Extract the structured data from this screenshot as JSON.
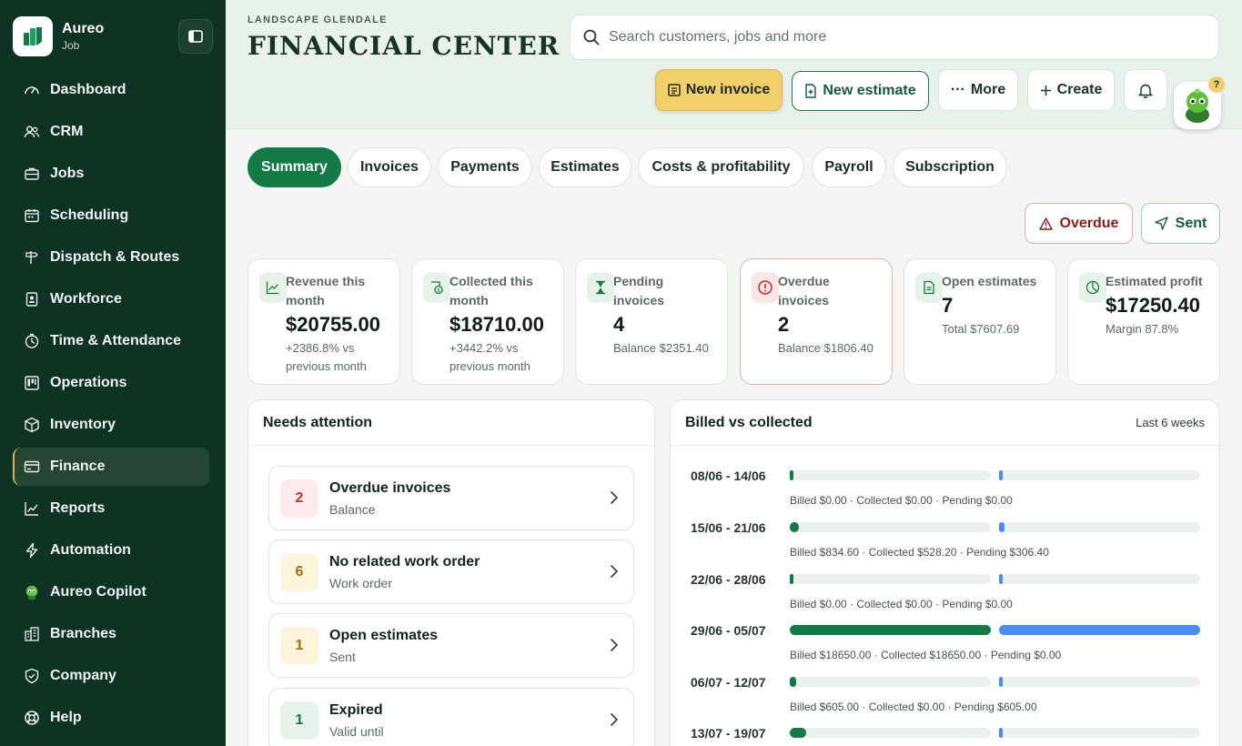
{
  "brand": {
    "name": "Aureo",
    "sub": "Job"
  },
  "nav": [
    {
      "label": "Dashboard",
      "icon": "dashboard-icon"
    },
    {
      "label": "CRM",
      "icon": "users-icon"
    },
    {
      "label": "Jobs",
      "icon": "briefcase-icon"
    },
    {
      "label": "Scheduling",
      "icon": "calendar-icon"
    },
    {
      "label": "Dispatch & Routes",
      "icon": "signpost-icon"
    },
    {
      "label": "Workforce",
      "icon": "id-badge-icon"
    },
    {
      "label": "Time & Attendance",
      "icon": "clock-icon"
    },
    {
      "label": "Operations",
      "icon": "kanban-icon"
    },
    {
      "label": "Inventory",
      "icon": "box-icon"
    },
    {
      "label": "Finance",
      "icon": "card-icon",
      "active": true
    },
    {
      "label": "Reports",
      "icon": "chart-line-icon"
    },
    {
      "label": "Automation",
      "icon": "bolt-icon"
    },
    {
      "label": "Aureo Copilot",
      "icon": "copilot-icon"
    },
    {
      "label": "Branches",
      "icon": "building-icon"
    },
    {
      "label": "Company",
      "icon": "shield-icon"
    },
    {
      "label": "Help",
      "icon": "lifebuoy-icon"
    }
  ],
  "header": {
    "org": "LANDSCAPE GLENDALE",
    "title": "FINANCIAL CENTER",
    "search_placeholder": "Search customers, jobs and more",
    "new_invoice": "New invoice",
    "new_estimate": "New estimate",
    "more": "More",
    "create": "Create",
    "mascot_badge": "?"
  },
  "tabs": [
    "Summary",
    "Invoices",
    "Payments",
    "Estimates",
    "Costs & profitability",
    "Payroll",
    "Subscription"
  ],
  "filters": {
    "overdue": "Overdue",
    "sent": "Sent"
  },
  "kpis": [
    {
      "label": "Revenue this month",
      "value": "$20755.00",
      "sub": "+2386.8% vs previous month",
      "icon": "trend-up-icon"
    },
    {
      "label": "Collected this month",
      "value": "$18710.00",
      "sub": "+3442.2% vs previous month",
      "icon": "cash-icon"
    },
    {
      "label": "Pending invoices",
      "value": "4",
      "sub": "Balance $2351.40",
      "icon": "hourglass-icon"
    },
    {
      "label": "Overdue invoices",
      "value": "2",
      "sub": "Balance $1806.40",
      "icon": "alert-icon",
      "danger": true
    },
    {
      "label": "Open estimates",
      "value": "7",
      "sub": "Total $7607.69",
      "icon": "document-icon"
    },
    {
      "label": "Estimated profit",
      "value": "$17250.40",
      "sub": "Margin 87.8%",
      "icon": "pie-icon"
    }
  ],
  "attention": {
    "title": "Needs attention",
    "items": [
      {
        "count": "2",
        "title": "Overdue invoices",
        "sub": "Balance",
        "tone": "red"
      },
      {
        "count": "6",
        "title": "No related work order",
        "sub": "Work order",
        "tone": "amber"
      },
      {
        "count": "1",
        "title": "Open estimates",
        "sub": "Sent",
        "tone": "amber"
      },
      {
        "count": "1",
        "title": "Expired",
        "sub": "Valid until",
        "tone": "green"
      }
    ]
  },
  "billed": {
    "title": "Billed vs collected",
    "period": "Last 6 weeks",
    "colors": {
      "billed": "#137a45",
      "collected": "#4a8cf0",
      "track": "#ebf1ed"
    },
    "rows": [
      {
        "week": "08/06 - 14/06",
        "billed": 0,
        "collected": 0,
        "caption": "Billed $0.00 · Collected $0.00 · Pending $0.00"
      },
      {
        "week": "15/06 - 21/06",
        "billed": 834.6,
        "collected": 528.2,
        "caption": "Billed $834.60 · Collected $528.20 · Pending $306.40"
      },
      {
        "week": "22/06 - 28/06",
        "billed": 0,
        "collected": 0,
        "caption": "Billed $0.00 · Collected $0.00 · Pending $0.00"
      },
      {
        "week": "29/06 - 05/07",
        "billed": 18650,
        "collected": 18650,
        "caption": "Billed $18650.00 · Collected $18650.00 · Pending $0.00"
      },
      {
        "week": "06/07 - 12/07",
        "billed": 605,
        "collected": 0,
        "caption": "Billed $605.00 · Collected $0.00 · Pending $605.00"
      },
      {
        "week": "13/07 - 19/07",
        "billed": 1500,
        "collected": 0,
        "caption": ""
      }
    ],
    "max": 18650
  }
}
